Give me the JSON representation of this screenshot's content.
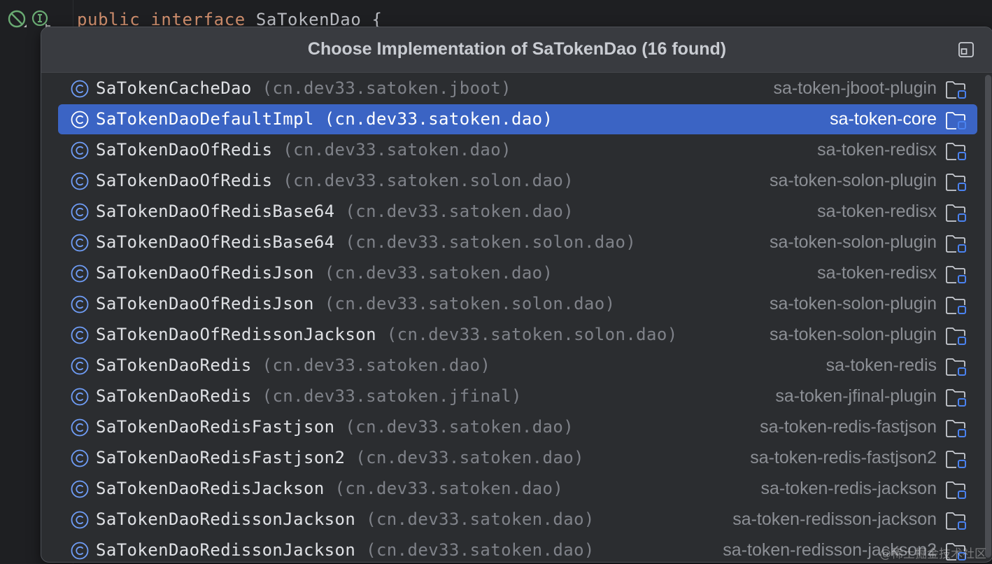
{
  "editor": {
    "code_keyword_1": "public",
    "code_keyword_2": "interface",
    "code_class": "SaTokenDao",
    "code_brace": "{"
  },
  "popup": {
    "title": "Choose Implementation of SaTokenDao (16 found)",
    "pin_icon": "open-in-window-icon",
    "items": [
      {
        "name": "SaTokenCacheDao",
        "package": "(cn.dev33.satoken.jboot)",
        "module": "sa-token-jboot-plugin"
      },
      {
        "name": "SaTokenDaoDefaultImpl",
        "package": "(cn.dev33.satoken.dao)",
        "module": "sa-token-core",
        "selected": true
      },
      {
        "name": "SaTokenDaoOfRedis",
        "package": "(cn.dev33.satoken.dao)",
        "module": "sa-token-redisx"
      },
      {
        "name": "SaTokenDaoOfRedis",
        "package": "(cn.dev33.satoken.solon.dao)",
        "module": "sa-token-solon-plugin"
      },
      {
        "name": "SaTokenDaoOfRedisBase64",
        "package": "(cn.dev33.satoken.dao)",
        "module": "sa-token-redisx"
      },
      {
        "name": "SaTokenDaoOfRedisBase64",
        "package": "(cn.dev33.satoken.solon.dao)",
        "module": "sa-token-solon-plugin"
      },
      {
        "name": "SaTokenDaoOfRedisJson",
        "package": "(cn.dev33.satoken.dao)",
        "module": "sa-token-redisx"
      },
      {
        "name": "SaTokenDaoOfRedisJson",
        "package": "(cn.dev33.satoken.solon.dao)",
        "module": "sa-token-solon-plugin"
      },
      {
        "name": "SaTokenDaoOfRedissonJackson",
        "package": "(cn.dev33.satoken.solon.dao)",
        "module": "sa-token-solon-plugin"
      },
      {
        "name": "SaTokenDaoRedis",
        "package": "(cn.dev33.satoken.dao)",
        "module": "sa-token-redis"
      },
      {
        "name": "SaTokenDaoRedis",
        "package": "(cn.dev33.satoken.jfinal)",
        "module": "sa-token-jfinal-plugin"
      },
      {
        "name": "SaTokenDaoRedisFastjson",
        "package": "(cn.dev33.satoken.dao)",
        "module": "sa-token-redis-fastjson"
      },
      {
        "name": "SaTokenDaoRedisFastjson2",
        "package": "(cn.dev33.satoken.dao)",
        "module": "sa-token-redis-fastjson2"
      },
      {
        "name": "SaTokenDaoRedisJackson",
        "package": "(cn.dev33.satoken.dao)",
        "module": "sa-token-redis-jackson"
      },
      {
        "name": "SaTokenDaoRedissonJackson",
        "package": "(cn.dev33.satoken.dao)",
        "module": "sa-token-redisson-jackson"
      },
      {
        "name": "SaTokenDaoRedissonJackson",
        "package": "(cn.dev33.satoken.dao)",
        "module": "sa-token-redisson-jackson2"
      }
    ]
  },
  "colors": {
    "selection": "#3b64c4",
    "class_icon_stroke": "#6f9df7",
    "folder_badge": "#4a82f0"
  },
  "watermark": "@稀土掘金技术社区"
}
